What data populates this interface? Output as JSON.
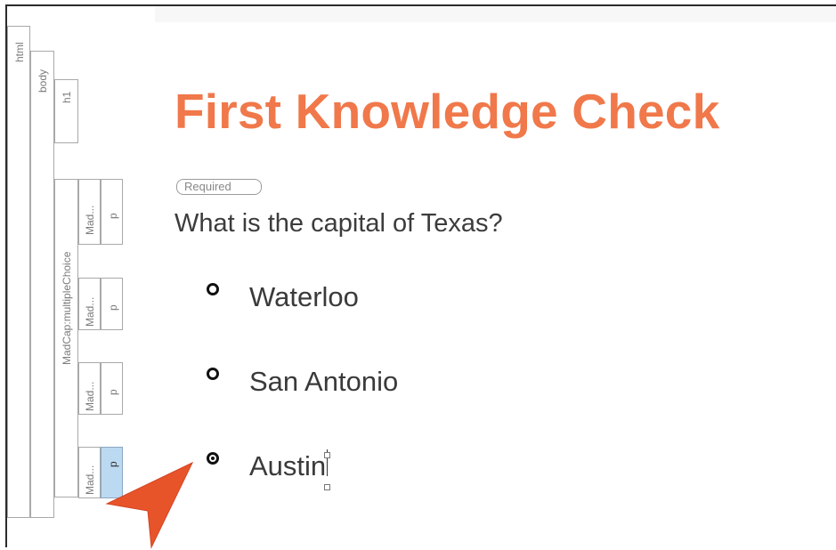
{
  "structure_bar": {
    "tags": {
      "html": "html",
      "body": "body",
      "h1": "h1",
      "multiple_choice": "MadCap:multipleChoice",
      "option_tag": "Mad...",
      "p": "p"
    }
  },
  "editor": {
    "heading": "First Knowledge Check",
    "required_badge": "Required",
    "question": "What is the capital of Texas?",
    "options": [
      {
        "label": "Waterloo",
        "selected": false
      },
      {
        "label": "San Antonio",
        "selected": false
      },
      {
        "label": "Austin",
        "selected": true
      }
    ]
  },
  "colors": {
    "heading": "#f0784a",
    "selected_tag": "#bcd9f2",
    "pointer": "#e8542a"
  },
  "icons": [
    "radio-unchecked-icon",
    "radio-checked-icon",
    "pointer-arrow-icon"
  ]
}
